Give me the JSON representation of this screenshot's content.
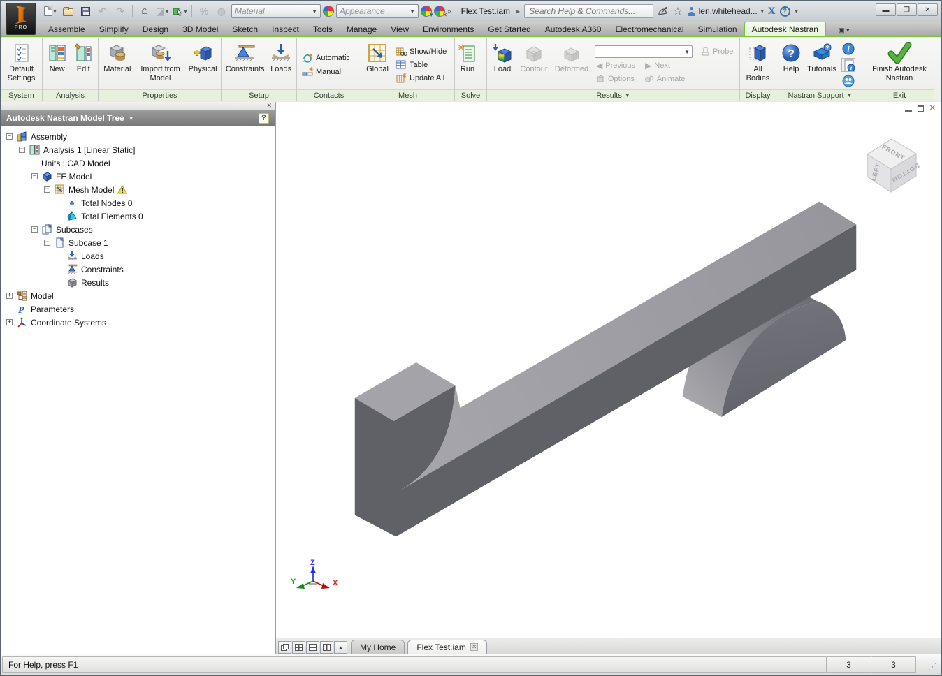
{
  "app": {
    "logo_sub": "PRO"
  },
  "titlebar": {
    "document_title": "Flex Test.iam",
    "search_placeholder": "Search Help & Commands...",
    "user_name": "len.whitehead...",
    "material_placeholder": "Material",
    "appearance_placeholder": "Appearance"
  },
  "tabs": {
    "items": [
      "Assemble",
      "Simplify",
      "Design",
      "3D Model",
      "Sketch",
      "Inspect",
      "Tools",
      "Manage",
      "View",
      "Environments",
      "Get Started",
      "Autodesk A360",
      "Electromechanical",
      "Simulation",
      "Autodesk Nastran"
    ],
    "active": "Autodesk Nastran"
  },
  "ribbon": {
    "groups": [
      {
        "label": "System",
        "buttons": [
          {
            "label": "Default Settings",
            "icon": "default-settings"
          }
        ]
      },
      {
        "label": "Analysis",
        "buttons": [
          {
            "label": "New",
            "icon": "analysis-new"
          },
          {
            "label": "Edit",
            "icon": "analysis-edit"
          }
        ]
      },
      {
        "label": "Properties",
        "buttons": [
          {
            "label": "Material",
            "icon": "material"
          },
          {
            "label": "Import from Model",
            "icon": "import-from-model"
          },
          {
            "label": "Physical",
            "icon": "physical"
          }
        ]
      },
      {
        "label": "Setup",
        "buttons": [
          {
            "label": "Constraints",
            "icon": "constraints"
          },
          {
            "label": "Loads",
            "icon": "loads"
          }
        ]
      },
      {
        "label": "Contacts",
        "buttons": [
          {
            "label": "Automatic",
            "icon": "automatic"
          },
          {
            "label": "Manual",
            "icon": "manual"
          }
        ]
      },
      {
        "label": "Mesh",
        "buttons": [
          {
            "label": "Global",
            "icon": "global"
          },
          {
            "label": "Show/Hide",
            "icon": "show-hide"
          },
          {
            "label": "Table",
            "icon": "table"
          },
          {
            "label": "Update All",
            "icon": "update-all"
          }
        ]
      },
      {
        "label": "Solve",
        "buttons": [
          {
            "label": "Run",
            "icon": "run"
          }
        ]
      },
      {
        "label": "Results",
        "buttons": [
          {
            "label": "Load",
            "icon": "load-results"
          },
          {
            "label": "Contour",
            "icon": "contour",
            "disabled": true
          },
          {
            "label": "Deformed",
            "icon": "deformed",
            "disabled": true
          },
          {
            "label": "Probe",
            "disabled": true
          },
          {
            "label": "Previous",
            "disabled": true
          },
          {
            "label": "Next",
            "disabled": true
          },
          {
            "label": "Options",
            "disabled": true
          },
          {
            "label": "Animate",
            "disabled": true
          }
        ]
      },
      {
        "label": "Display",
        "buttons": [
          {
            "label": "All Bodies",
            "icon": "all-bodies"
          }
        ]
      },
      {
        "label": "Nastran Support",
        "buttons": [
          {
            "label": "Help",
            "icon": "help"
          },
          {
            "label": "Tutorials",
            "icon": "tutorials"
          }
        ]
      },
      {
        "label": "Exit",
        "buttons": [
          {
            "label": "Finish Autodesk Nastran",
            "icon": "finish"
          }
        ]
      }
    ]
  },
  "panel": {
    "title": "Autodesk Nastran Model Tree"
  },
  "tree": {
    "items": [
      {
        "label": "Assembly",
        "depth": 0,
        "expander": "minus",
        "icon": "assembly"
      },
      {
        "label": "Analysis 1 [Linear Static]",
        "depth": 1,
        "expander": "minus",
        "icon": "analysis"
      },
      {
        "label": "Units : CAD Model",
        "depth": 2,
        "expander": "none",
        "icon": "none"
      },
      {
        "label": "FE Model",
        "depth": 2,
        "expander": "minus",
        "icon": "fe-model"
      },
      {
        "label": "Mesh Model",
        "depth": 3,
        "expander": "minus",
        "icon": "mesh",
        "badge": "warning"
      },
      {
        "label": "Total Nodes 0",
        "depth": 4,
        "expander": "none",
        "icon": "node"
      },
      {
        "label": "Total Elements 0",
        "depth": 4,
        "expander": "none",
        "icon": "element"
      },
      {
        "label": "Subcases",
        "depth": 2,
        "expander": "minus",
        "icon": "subcases"
      },
      {
        "label": "Subcase 1",
        "depth": 3,
        "expander": "minus",
        "icon": "subcase"
      },
      {
        "label": "Loads",
        "depth": 4,
        "expander": "none",
        "icon": "loads"
      },
      {
        "label": "Constraints",
        "depth": 4,
        "expander": "none",
        "icon": "constraints"
      },
      {
        "label": "Results",
        "depth": 4,
        "expander": "none",
        "icon": "results"
      },
      {
        "label": "Model",
        "depth": 0,
        "expander": "plus",
        "icon": "model"
      },
      {
        "label": "Parameters",
        "depth": 0,
        "expander": "none",
        "icon": "parameters"
      },
      {
        "label": "Coordinate Systems",
        "depth": 0,
        "expander": "plus",
        "icon": "coordinate-systems"
      }
    ]
  },
  "viewport": {
    "viewcube": {
      "top": "FRONT",
      "left": "LEFT",
      "right": "BOTTOM"
    },
    "triad": {
      "x": "X",
      "y": "Y",
      "z": "Z"
    },
    "doc_tabs": [
      {
        "label": "My Home",
        "active": false,
        "closable": false
      },
      {
        "label": "Flex Test.iam",
        "active": true,
        "closable": true
      }
    ]
  },
  "statusbar": {
    "message": "For Help, press F1",
    "cells": [
      "3",
      "3"
    ]
  },
  "colors": {
    "accent_green": "#7cc13e",
    "beam_top": "#9a9aa0",
    "beam_front": "#606067",
    "dome_face": "#65656d",
    "ribbon_cap": "#e6f1dc"
  }
}
